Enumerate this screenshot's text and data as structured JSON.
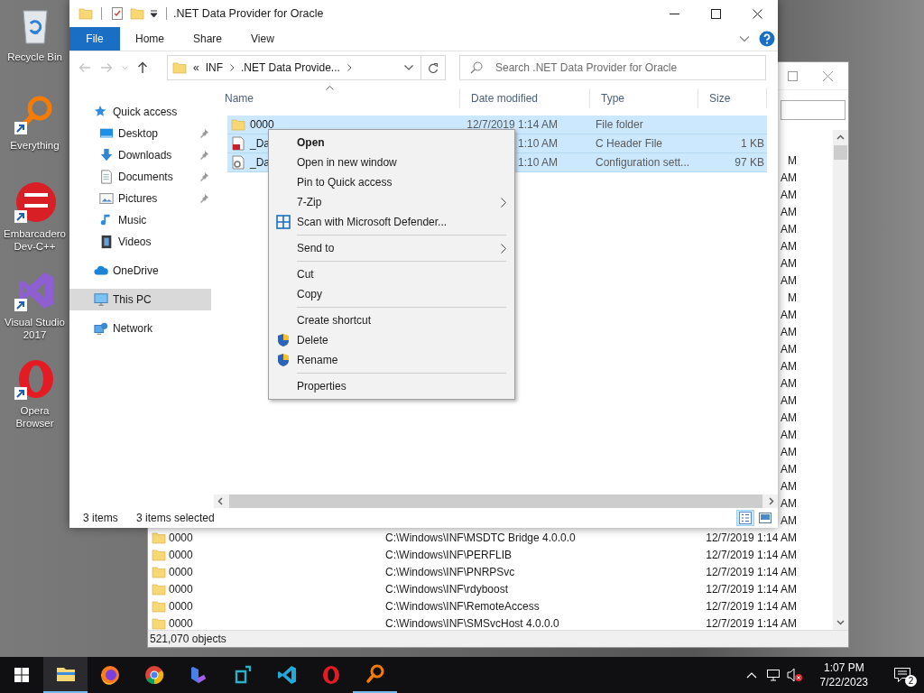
{
  "desktop_icons": [
    {
      "label": "Recycle Bin",
      "kind": "recycle",
      "shortcut": false
    },
    {
      "label": "Everything",
      "kind": "everything",
      "shortcut": true
    },
    {
      "label": "Embarcadero Dev-C++",
      "kind": "devcpp",
      "shortcut": true
    },
    {
      "label": "Visual Studio 2017",
      "kind": "vs",
      "shortcut": true
    },
    {
      "label": "Opera Browser",
      "kind": "opera",
      "shortcut": true
    }
  ],
  "search_window": {
    "rows": [
      {
        "kind": "partial",
        "date": "M"
      },
      {
        "kind": "partial",
        "date": "AM"
      },
      {
        "kind": "partial",
        "date": "AM"
      },
      {
        "kind": "partial",
        "date": "AM"
      },
      {
        "kind": "partial",
        "date": "AM"
      },
      {
        "kind": "partial",
        "date": "AM"
      },
      {
        "kind": "partial",
        "date": "AM"
      },
      {
        "kind": "partial",
        "date": "AM"
      },
      {
        "kind": "partial",
        "date": "M"
      },
      {
        "kind": "partial",
        "date": "AM"
      },
      {
        "kind": "partial",
        "date": "AM"
      },
      {
        "kind": "partial",
        "date": "AM"
      },
      {
        "kind": "partial",
        "date": "AM"
      },
      {
        "kind": "partial",
        "date": "AM"
      },
      {
        "kind": "partial",
        "date": "AM"
      },
      {
        "kind": "partial",
        "date": "AM"
      },
      {
        "kind": "partial",
        "date": "AM"
      },
      {
        "kind": "partial",
        "date": "AM"
      },
      {
        "kind": "partial",
        "date": "AM"
      },
      {
        "kind": "partial",
        "date": "AM"
      },
      {
        "kind": "partial",
        "date": "AM"
      },
      {
        "kind": "partial",
        "date": "AM"
      },
      {
        "kind": "full",
        "name": "0000",
        "path": "C:\\Windows\\INF\\MSDTC Bridge 4.0.0.0",
        "date": "12/7/2019 1:14 AM"
      },
      {
        "kind": "full",
        "name": "0000",
        "path": "C:\\Windows\\INF\\PERFLIB",
        "date": "12/7/2019 1:14 AM"
      },
      {
        "kind": "full",
        "name": "0000",
        "path": "C:\\Windows\\INF\\PNRPSvc",
        "date": "12/7/2019 1:14 AM"
      },
      {
        "kind": "full",
        "name": "0000",
        "path": "C:\\Windows\\INF\\rdyboost",
        "date": "12/7/2019 1:14 AM"
      },
      {
        "kind": "full",
        "name": "0000",
        "path": "C:\\Windows\\INF\\RemoteAccess",
        "date": "12/7/2019 1:14 AM"
      },
      {
        "kind": "full",
        "name": "0000",
        "path": "C:\\Windows\\INF\\SMSvcHost 4.0.0.0",
        "date": "12/7/2019 1:14 AM"
      }
    ],
    "status": "521,070 objects"
  },
  "explorer": {
    "title": ".NET Data Provider for Oracle",
    "ribbon_tabs": [
      {
        "label": "File",
        "kind": "file"
      },
      {
        "label": "Home",
        "kind": "tab"
      },
      {
        "label": "Share",
        "kind": "tab"
      },
      {
        "label": "View",
        "kind": "tab"
      }
    ],
    "address": {
      "overflow": "«",
      "crumbs": [
        "INF",
        ".NET Data Provide..."
      ]
    },
    "search_placeholder": "Search .NET Data Provider for Oracle",
    "nav": [
      {
        "label": "Quick access",
        "kind": "star",
        "selected": false,
        "children": [
          {
            "label": "Desktop",
            "kind": "desktop",
            "pinned": true,
            "selected": false
          },
          {
            "label": "Downloads",
            "kind": "downloads",
            "pinned": true,
            "selected": false
          },
          {
            "label": "Documents",
            "kind": "documents",
            "pinned": true,
            "selected": false
          },
          {
            "label": "Pictures",
            "kind": "pictures",
            "pinned": true,
            "selected": false
          },
          {
            "label": "Music",
            "kind": "music",
            "pinned": false,
            "selected": false
          },
          {
            "label": "Videos",
            "kind": "videos",
            "pinned": false,
            "selected": false
          }
        ]
      },
      {
        "label": "OneDrive",
        "kind": "cloud",
        "selected": false
      },
      {
        "label": "This PC",
        "kind": "pc",
        "selected": true
      },
      {
        "label": "Network",
        "kind": "network",
        "selected": false
      }
    ],
    "columns": [
      {
        "label": "Name",
        "sorted": true
      },
      {
        "label": "Date modified",
        "sorted": false
      },
      {
        "label": "Type",
        "sorted": false
      },
      {
        "label": "Size",
        "sorted": false
      }
    ],
    "files": [
      {
        "kind": "folder",
        "name": "0000",
        "date": "12/7/2019 1:14 AM",
        "type": "File folder",
        "selected": true
      },
      {
        "kind": "header",
        "name": "_Da",
        "date": "1:10 AM",
        "type": "C Header File",
        "size": "1 KB",
        "selected": true
      },
      {
        "kind": "config",
        "name": "_Da",
        "date": "1:10 AM",
        "type": "Configuration sett...",
        "size": "97 KB",
        "selected": true
      }
    ],
    "status": {
      "count": "3 items",
      "selection": "3 items selected"
    },
    "views": [
      {
        "kind": "details",
        "selected": true
      },
      {
        "kind": "tiles",
        "selected": false
      }
    ]
  },
  "context_menu": [
    {
      "kind": "item",
      "label": "Open",
      "default": true,
      "submenu": false
    },
    {
      "kind": "item",
      "label": "Open in new window",
      "default": false,
      "submenu": false
    },
    {
      "kind": "item",
      "label": "Pin to Quick access",
      "default": false,
      "submenu": false
    },
    {
      "kind": "item",
      "label": "7-Zip",
      "default": false,
      "submenu": true
    },
    {
      "kind": "scan",
      "label": "Scan with Microsoft Defender...",
      "default": false,
      "submenu": false
    },
    {
      "kind": "separator"
    },
    {
      "kind": "item",
      "label": "Send to",
      "default": false,
      "submenu": true
    },
    {
      "kind": "separator"
    },
    {
      "kind": "item",
      "label": "Cut",
      "default": false,
      "submenu": false
    },
    {
      "kind": "item",
      "label": "Copy",
      "default": false,
      "submenu": false
    },
    {
      "kind": "separator"
    },
    {
      "kind": "item",
      "label": "Create shortcut",
      "default": false,
      "submenu": false
    },
    {
      "kind": "elevated",
      "label": "Delete",
      "default": false,
      "submenu": false
    },
    {
      "kind": "elevated",
      "label": "Rename",
      "default": false,
      "submenu": false
    },
    {
      "kind": "separator"
    },
    {
      "kind": "item",
      "label": "Properties",
      "default": false,
      "submenu": false
    }
  ],
  "taskbar": {
    "apps": [
      {
        "kind": "explorer",
        "running": true,
        "active": true
      },
      {
        "kind": "firefox",
        "running": false,
        "active": false
      },
      {
        "kind": "chrome",
        "running": false,
        "active": false
      },
      {
        "kind": "copilot",
        "running": false,
        "active": false
      },
      {
        "kind": "devapp",
        "running": false,
        "active": false
      },
      {
        "kind": "vscode",
        "running": false,
        "active": false
      },
      {
        "kind": "opera",
        "running": false,
        "active": false
      },
      {
        "kind": "everything",
        "running": true,
        "active": false
      }
    ],
    "volume_muted": true,
    "time": "1:07 PM",
    "date": "7/22/2023",
    "notifications": "2"
  }
}
